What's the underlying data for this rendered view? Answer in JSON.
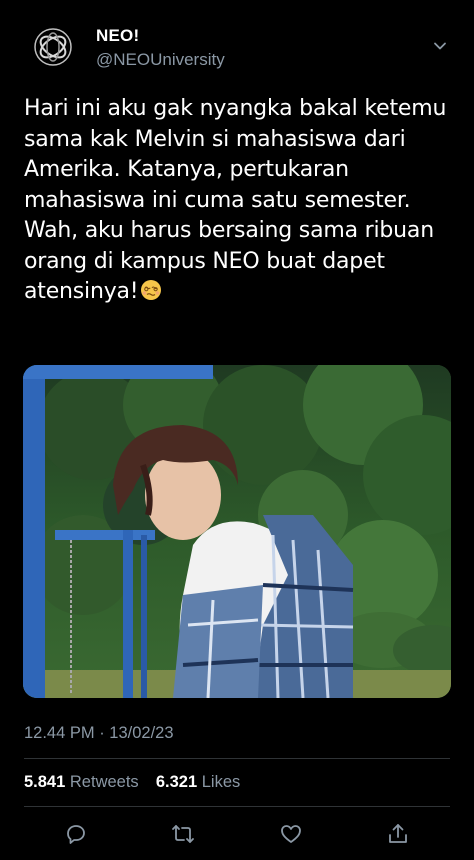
{
  "account": {
    "display_name": "NEO!",
    "handle": "@NEOUniversity",
    "avatar_icon": "neo-logo-icon"
  },
  "tweet": {
    "lines": [
      "Hari ini aku gak nyangka bakal ketemu",
      "sama kak Melvin si mahasiswa dari",
      "Amerika. Katanya, pertukaran",
      "mahasiswa ini cuma satu semester.",
      "Wah, aku harus bersaing sama ribuan",
      "orang di kampus NEO buat dapet",
      "atensinya!"
    ],
    "emoji": "woozy-face-emoji",
    "media_alt_icon": "photo"
  },
  "meta": {
    "timestamp": "12.44 PM · 13/02/23"
  },
  "stats": {
    "retweets_count": "5.841",
    "retweets_label": "Retweets",
    "likes_count": "6.321",
    "likes_label": "Likes"
  },
  "actions": {
    "reply_icon": "reply-icon",
    "retweet_icon": "retweet-icon",
    "like_icon": "heart-icon",
    "share_icon": "share-icon"
  },
  "colors": {
    "background": "#000000",
    "text": "#ffffff",
    "secondary": "#8b98a5",
    "divider": "#2f3336"
  }
}
